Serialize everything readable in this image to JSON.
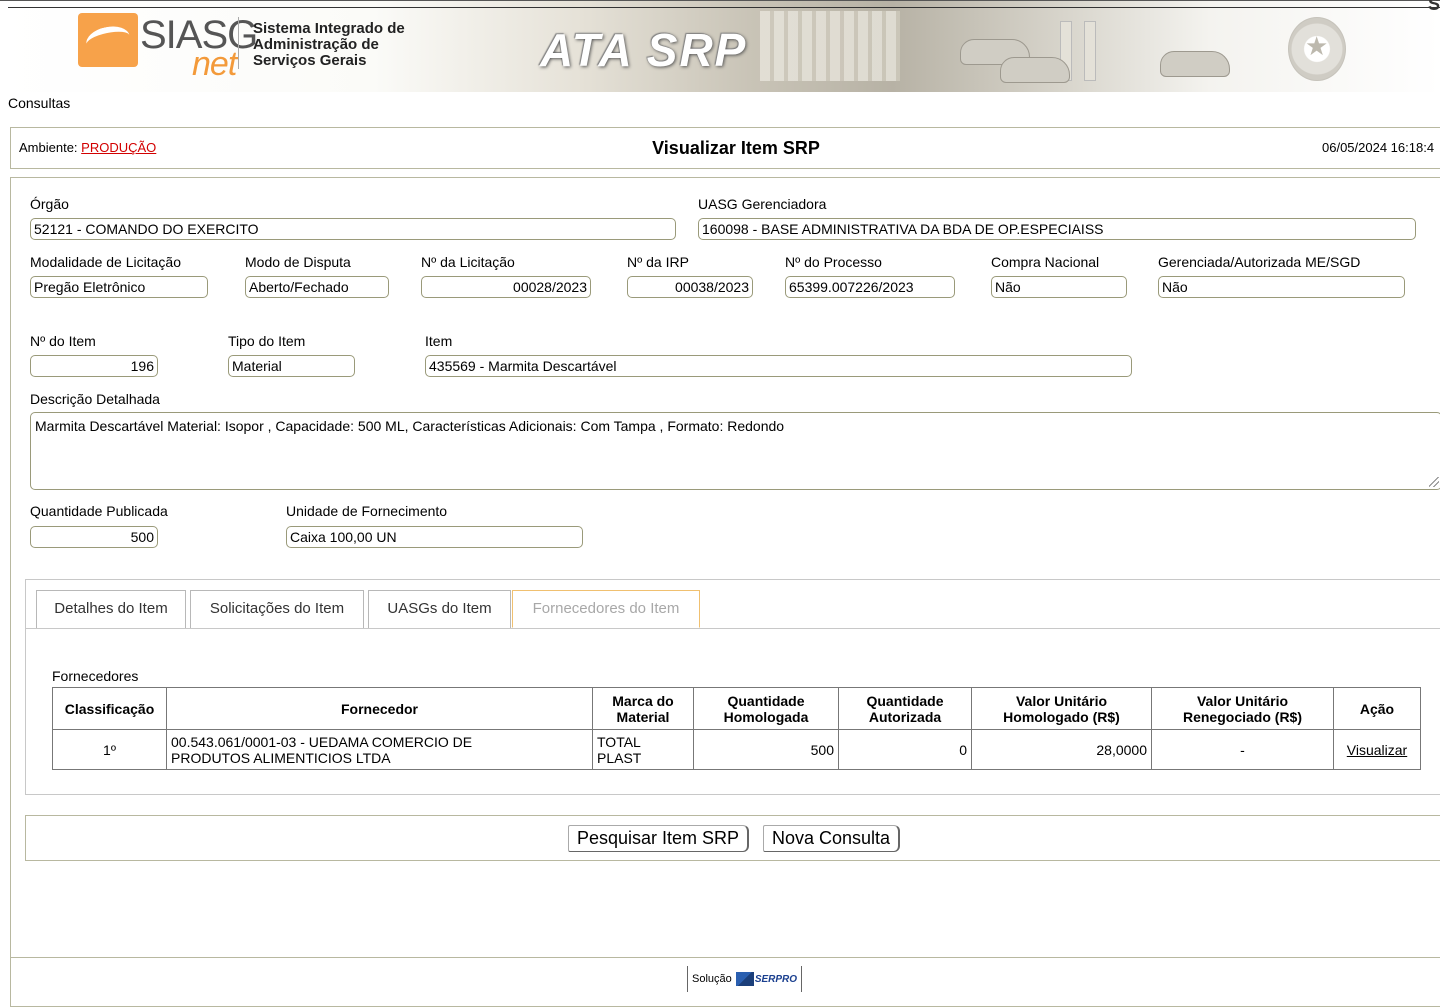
{
  "header": {
    "logo_siasg": "SIASG",
    "logo_net": "net",
    "logo_line1": "Sistema Integrado de",
    "logo_line2": "Administração de",
    "logo_line3": "Serviços Gerais",
    "banner_title": "ATA SRP"
  },
  "menu": {
    "consultas": "Consultas"
  },
  "titlebar": {
    "ambiente_label": "Ambiente:",
    "ambiente_value": "PRODUÇÃO",
    "page_title": "Visualizar Item SRP",
    "datetime": "06/05/2024 16:18:4"
  },
  "form": {
    "orgao": {
      "label": "Órgão",
      "value": "52121 - COMANDO DO EXERCITO"
    },
    "uasg": {
      "label": "UASG Gerenciadora",
      "value": "160098 - BASE ADMINISTRATIVA DA BDA DE OP.ESPECIAISS"
    },
    "modalidade": {
      "label": "Modalidade de Licitação",
      "value": "Pregão Eletrônico"
    },
    "modo_disputa": {
      "label": "Modo de Disputa",
      "value": "Aberto/Fechado"
    },
    "num_licitacao": {
      "label": "Nº da Licitação",
      "value": "00028/2023"
    },
    "num_irp": {
      "label": "Nº da IRP",
      "value": "00038/2023"
    },
    "num_processo": {
      "label": "Nº do Processo",
      "value": "65399.007226/2023"
    },
    "compra_nacional": {
      "label": "Compra Nacional",
      "value": "Não"
    },
    "gerenciada": {
      "label": "Gerenciada/Autorizada ME/SGD",
      "value": "Não"
    },
    "num_item": {
      "label": "Nº do Item",
      "value": "196"
    },
    "tipo_item": {
      "label": "Tipo do Item",
      "value": "Material"
    },
    "item": {
      "label": "Item",
      "value": "435569 - Marmita Descartável"
    },
    "descricao": {
      "label": "Descrição Detalhada",
      "value": "Marmita Descartável Material: Isopor , Capacidade: 500 ML, Características Adicionais: Com Tampa , Formato: Redondo"
    },
    "quantidade": {
      "label": "Quantidade Publicada",
      "value": "500"
    },
    "unidade": {
      "label": "Unidade de Fornecimento",
      "value": "Caixa 100,00 UN"
    }
  },
  "tabs": [
    {
      "label": "Detalhes do Item"
    },
    {
      "label": "Solicitações do Item"
    },
    {
      "label": "UASGs do Item"
    },
    {
      "label": "Fornecedores do Item"
    }
  ],
  "fornecedores": {
    "caption": "Fornecedores",
    "headers": {
      "classificacao": "Classificação",
      "fornecedor": "Fornecedor",
      "marca_1": "Marca do",
      "marca_2": "Material",
      "qhom_1": "Quantidade",
      "qhom_2": "Homologada",
      "qaut_1": "Quantidade",
      "qaut_2": "Autorizada",
      "vuh_1": "Valor Unitário",
      "vuh_2": "Homologado (R$)",
      "vur_1": "Valor Unitário",
      "vur_2": "Renegociado (R$)",
      "acao": "Ação"
    },
    "rows": [
      {
        "classificacao": "1º",
        "fornecedor_1": "00.543.061/0001-03 - UEDAMA COMERCIO DE",
        "fornecedor_2": "PRODUTOS ALIMENTICIOS LTDA",
        "marca_1": "TOTAL",
        "marca_2": "PLAST",
        "qtd_homologada": "500",
        "qtd_autorizada": "0",
        "valor_homologado": "28,0000",
        "valor_renegociado": "-",
        "acao": "Visualizar"
      }
    ]
  },
  "buttons": {
    "pesquisar": "Pesquisar Item SRP",
    "nova": "Nova Consulta"
  },
  "footer": {
    "solucao": "Solução",
    "serpro": "SERPRO"
  },
  "colors": {
    "ambiente": "#d20000",
    "active_tab_border": "#f0c070",
    "logo_orange": "#f7a24a"
  }
}
